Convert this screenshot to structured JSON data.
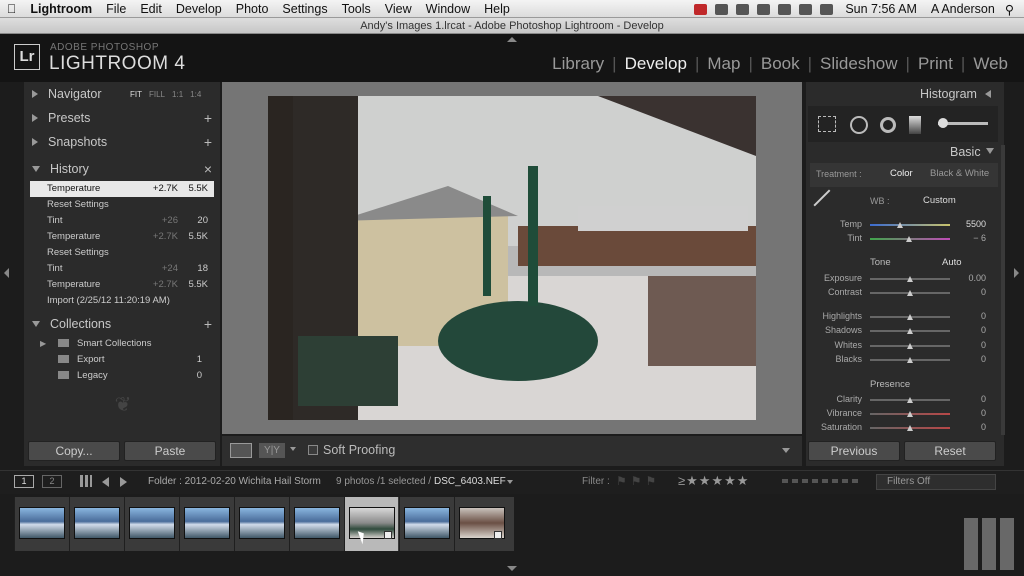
{
  "menubar": {
    "apple": "",
    "app": "Lightroom",
    "items": [
      "File",
      "Edit",
      "Develop",
      "Photo",
      "Settings",
      "Tools",
      "View",
      "Window",
      "Help"
    ],
    "clock": "Sun 7:56 AM",
    "user": "A Anderson"
  },
  "window": {
    "title": "Andy's Images 1.lrcat - Adobe Photoshop Lightroom - Develop"
  },
  "identity": {
    "brand_small": "ADOBE PHOTOSHOP",
    "brand_large": "LIGHTROOM 4",
    "logo": "Lr"
  },
  "modules": [
    "Library",
    "Develop",
    "Map",
    "Book",
    "Slideshow",
    "Print",
    "Web"
  ],
  "left": {
    "navigator": {
      "label": "Navigator",
      "zoom": [
        "FIT",
        "FILL",
        "1:1",
        "1:4"
      ]
    },
    "presets": "Presets",
    "snapshots": "Snapshots",
    "history": {
      "label": "History",
      "items": [
        {
          "name": "Temperature",
          "a": "+2.7K",
          "b": "5.5K"
        },
        {
          "name": "Reset Settings",
          "a": "",
          "b": ""
        },
        {
          "name": "Tint",
          "a": "+26",
          "b": "20"
        },
        {
          "name": "Temperature",
          "a": "+2.7K",
          "b": "5.5K"
        },
        {
          "name": "Reset Settings",
          "a": "",
          "b": ""
        },
        {
          "name": "Tint",
          "a": "+24",
          "b": "18"
        },
        {
          "name": "Temperature",
          "a": "+2.7K",
          "b": "5.5K"
        },
        {
          "name": "Import (2/25/12 11:20:19 AM)",
          "a": "",
          "b": ""
        }
      ]
    },
    "collections": {
      "label": "Collections",
      "items": [
        {
          "name": "Smart Collections",
          "count": ""
        },
        {
          "name": "Export",
          "count": "1"
        },
        {
          "name": "Legacy",
          "count": "0"
        }
      ]
    },
    "copy": "Copy...",
    "paste": "Paste"
  },
  "toolbar": {
    "soft_proofing": "Soft Proofing"
  },
  "right": {
    "histogram": "Histogram",
    "basic": "Basic",
    "treatment_label": "Treatment :",
    "treatment_color": "Color",
    "treatment_bw": "Black & White",
    "wb_label": "WB :",
    "wb_value": "Custom",
    "temp": {
      "label": "Temp",
      "value": "5500"
    },
    "tint": {
      "label": "Tint",
      "value": "− 6"
    },
    "tone": "Tone",
    "auto": "Auto",
    "exposure": {
      "label": "Exposure",
      "value": "0.00"
    },
    "contrast": {
      "label": "Contrast",
      "value": "0"
    },
    "highlights": {
      "label": "Highlights",
      "value": "0"
    },
    "shadows": {
      "label": "Shadows",
      "value": "0"
    },
    "whites": {
      "label": "Whites",
      "value": "0"
    },
    "blacks": {
      "label": "Blacks",
      "value": "0"
    },
    "presence": "Presence",
    "clarity": {
      "label": "Clarity",
      "value": "0"
    },
    "vibrance": {
      "label": "Vibrance",
      "value": "0"
    },
    "saturation": {
      "label": "Saturation",
      "value": "0"
    },
    "previous": "Previous",
    "reset": "Reset"
  },
  "filmbar": {
    "page1": "1",
    "page2": "2",
    "folder": "Folder : 2012-02-20 Wichita Hail Storm",
    "count": "9 photos /1 selected /",
    "file": "DSC_6403.NEF",
    "filter_label": "Filter :",
    "filters_off": "Filters Off"
  },
  "colors": {
    "panel": "#2b2b2b",
    "bg": "#141414",
    "selected": "#e8e8e8",
    "accent": "#eeeeee"
  }
}
